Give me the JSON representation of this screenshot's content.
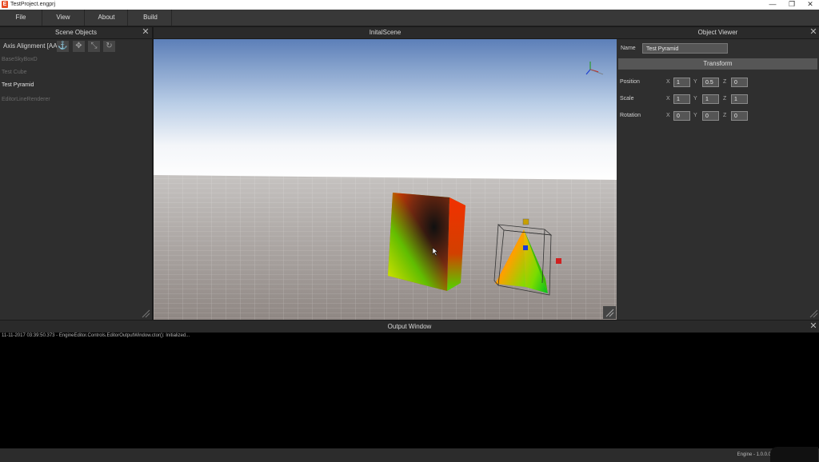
{
  "window": {
    "title": "TestProject.engprj",
    "app_icon": "E",
    "minimize": "—",
    "restore": "❐",
    "close": "✕"
  },
  "menu": [
    {
      "label": "File"
    },
    {
      "label": "View"
    },
    {
      "label": "About"
    },
    {
      "label": "Build"
    }
  ],
  "scene_objects": {
    "title": "Scene Objects",
    "axis_label": "Axis Alignment [AA]",
    "tools": [
      "anchor-icon",
      "move-icon",
      "scale-icon",
      "rotate-icon"
    ],
    "items": [
      {
        "label": "BaseSkyBoxD",
        "dim": true
      },
      {
        "label": "Test Cube",
        "dim": true
      },
      {
        "label": "Test Pyramid",
        "dim": false
      },
      {
        "label": "EditorLineRenderer",
        "dim": true
      }
    ]
  },
  "viewport": {
    "title": "InitalScene"
  },
  "object_viewer": {
    "title": "Object Viewer",
    "name_label": "Name",
    "name_value": "Test Pyramid",
    "section": "Transform",
    "axes": [
      "X",
      "Y",
      "Z"
    ],
    "props": [
      {
        "label": "Position",
        "values": [
          "1",
          "0.5",
          "0"
        ]
      },
      {
        "label": "Scale",
        "values": [
          "1",
          "1",
          "1"
        ]
      },
      {
        "label": "Rotation",
        "values": [
          "0",
          "0",
          "0"
        ]
      }
    ]
  },
  "output": {
    "title": "Output Window",
    "lines": [
      "11-11-2017 03:39:50.373 - EngineEditor.Controls.EditorOutputWindow.ctor(): Initialized..."
    ]
  },
  "status": {
    "text": "Engine - 1.0.0.0"
  },
  "colors": {
    "accent": "#e84c24",
    "panel": "#2e2e2e",
    "output_bg": "#000000"
  }
}
